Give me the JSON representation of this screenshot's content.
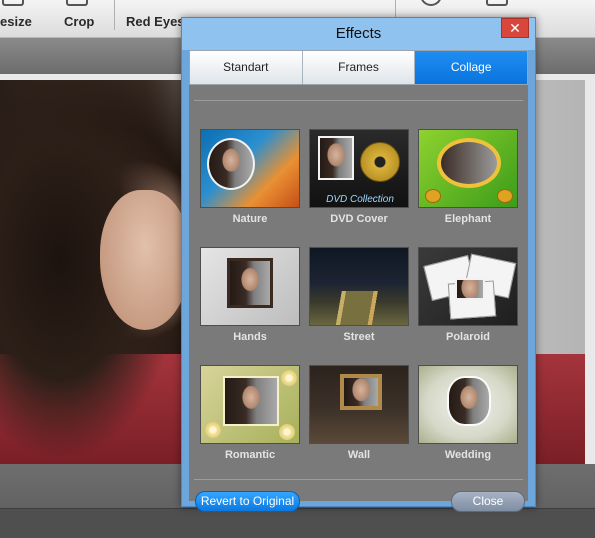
{
  "toolbar": {
    "buttons": [
      {
        "label": "esize"
      },
      {
        "label": "Crop"
      },
      {
        "label": "Red Eyes"
      }
    ]
  },
  "dialog": {
    "title": "Effects",
    "close_glyph": "✕",
    "tabs": [
      {
        "label": "Standart",
        "active": false
      },
      {
        "label": "Frames",
        "active": false
      },
      {
        "label": "Collage",
        "active": true
      }
    ],
    "effects": [
      {
        "label": "Nature",
        "icon": "nature-collage-thumbnail"
      },
      {
        "label": "DVD Cover",
        "icon": "dvd-cover-thumbnail",
        "thumb_text": "DVD Collection"
      },
      {
        "label": "Elephant",
        "icon": "elephant-collage-thumbnail"
      },
      {
        "label": "Hands",
        "icon": "hands-collage-thumbnail"
      },
      {
        "label": "Street",
        "icon": "street-collage-thumbnail"
      },
      {
        "label": "Polaroid",
        "icon": "polaroid-collage-thumbnail"
      },
      {
        "label": "Romantic",
        "icon": "romantic-collage-thumbnail"
      },
      {
        "label": "Wall",
        "icon": "wall-collage-thumbnail"
      },
      {
        "label": "Wedding",
        "icon": "wedding-collage-thumbnail"
      }
    ],
    "revert_label": "Revert to Original",
    "close_label": "Close"
  },
  "colors": {
    "active_tab": "#0a74dc",
    "dialog_frame": "#6da6da",
    "client_bg": "#7a7a7a",
    "close_x_bg": "#d9463c"
  }
}
